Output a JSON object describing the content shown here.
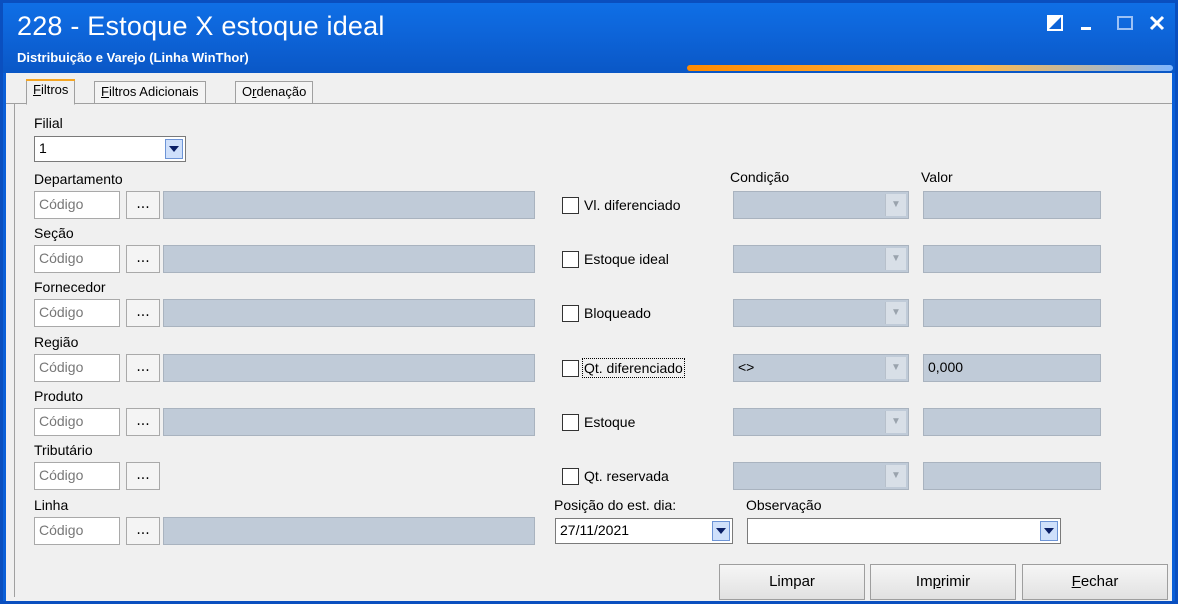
{
  "window": {
    "title": "228 - Estoque X estoque ideal",
    "subtitle": "Distribuição e Varejo (Linha WinThor)"
  },
  "tabs": [
    {
      "pre": "",
      "key": "F",
      "post": "iltros",
      "active": true
    },
    {
      "pre": "",
      "key": "F",
      "post": "iltros Adicionais",
      "active": false
    },
    {
      "pre": "O",
      "key": "r",
      "post": "denação",
      "active": false
    }
  ],
  "filial": {
    "label": "Filial",
    "value": "1"
  },
  "lookups": {
    "placeholder": "Código",
    "dots": "...",
    "items": [
      {
        "label": "Departamento"
      },
      {
        "label": "Seção"
      },
      {
        "label": "Fornecedor"
      },
      {
        "label": "Região"
      },
      {
        "label": "Produto"
      },
      {
        "label": "Tributário"
      },
      {
        "label": "Linha"
      }
    ]
  },
  "conditions": {
    "condicao_header": "Condição",
    "valor_header": "Valor",
    "rows": [
      {
        "label": "Vl. diferenciado",
        "checked": false,
        "condition": "",
        "value": ""
      },
      {
        "label": "Estoque ideal",
        "checked": false,
        "condition": "",
        "value": ""
      },
      {
        "label": "Bloqueado",
        "checked": false,
        "condition": "",
        "value": ""
      },
      {
        "label": "Qt. diferenciado",
        "checked": false,
        "condition": "<>",
        "value": "0,000"
      },
      {
        "label": "Estoque",
        "checked": false,
        "condition": "",
        "value": ""
      },
      {
        "label": "Qt. reservada",
        "checked": false,
        "condition": "",
        "value": ""
      }
    ]
  },
  "posicao": {
    "label": "Posição do est. dia:",
    "value": "27/11/2021"
  },
  "observacao": {
    "label": "Observação",
    "value": ""
  },
  "buttons": {
    "limpar": "Limpar",
    "imprimir_pre": "Im",
    "imprimir_key": "p",
    "imprimir_post": "rimir",
    "fechar_key": "F",
    "fechar_post": "echar"
  },
  "colors": {
    "title_bar": "#0d63d7",
    "accent": "#f5a623",
    "disabled_field": "#c0cbd8"
  }
}
